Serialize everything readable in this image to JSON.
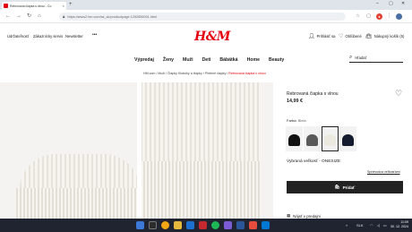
{
  "browser": {
    "tab_title": "Rebrovaná čiapka s vlnou - Čo",
    "url": "https://www2.hm.com/sk_sk/productpage.1252656001.html",
    "nav": {
      "back": "←",
      "forward": "→",
      "reload": "↻",
      "home": "⌂"
    },
    "tools": [
      "☆",
      "▢",
      "⋮"
    ]
  },
  "site": {
    "utility_links": [
      "Udržateľnosť",
      "Zákaznícky servis",
      "Newsletter"
    ],
    "more": "•••",
    "logo": "H&M",
    "account": {
      "signin": "Prihlásiť sa",
      "favourites": "Obľúbené",
      "cart": "Nákupný košík (5)"
    },
    "main_nav": [
      "Výpredaj",
      "Ženy",
      "Muži",
      "Deti",
      "Bábätká",
      "Home",
      "Beauty"
    ],
    "search_placeholder": "Hľadať",
    "breadcrumb": {
      "path": "HM.com / Muži / Čiapky Klobúky a čiapky / Pletené čiapky / ",
      "current": "Rebrovaná čiapka s vlnou"
    }
  },
  "product": {
    "name": "Rebrovaná čiapka s vlnou",
    "price": "14,99 €",
    "color_label": "Farba:",
    "color_value": "Biela",
    "swatches": [
      {
        "name": "black",
        "color": "#111111"
      },
      {
        "name": "grey",
        "color": "#5a5a5a"
      },
      {
        "name": "white",
        "color": "#ece9e1"
      },
      {
        "name": "navy",
        "color": "#141b2e"
      }
    ],
    "selected_swatch": 2,
    "size_text": "Vybraná veľkosť - ONESIZE",
    "size_guide": "Sprievodca veľkosťami",
    "add_button": "Pridať",
    "store_text": "Nájsť v predajni"
  },
  "taskbar": {
    "tray_lang": "SLK",
    "time": "11:09",
    "date": "30. 12. 2024"
  },
  "colors": {
    "brand": "#e50010",
    "button": "#222222",
    "taskbar": "#1f2430"
  }
}
